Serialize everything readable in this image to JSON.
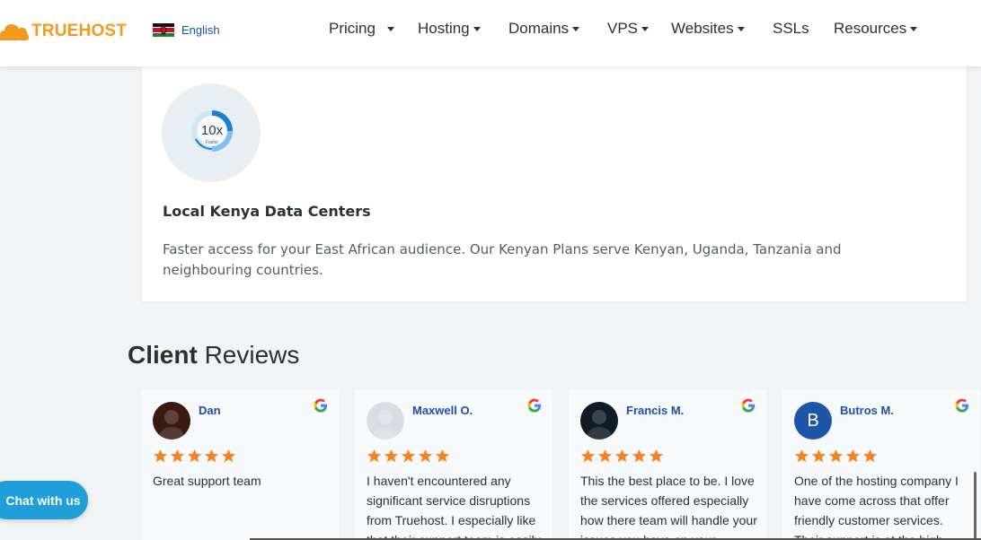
{
  "brand": {
    "name": "TRUEHOST",
    "color": "#f39a1e"
  },
  "language": {
    "label": "English",
    "flag": "kenya-flag-icon"
  },
  "menu": [
    {
      "label": "Pricing",
      "dropdown": true
    },
    {
      "label": "Hosting",
      "dropdown": true
    },
    {
      "label": "Domains",
      "dropdown": true
    },
    {
      "label": "VPS",
      "dropdown": true
    },
    {
      "label": "Websites",
      "dropdown": true
    },
    {
      "label": "SSLs",
      "dropdown": false
    },
    {
      "label": "Resources",
      "dropdown": true
    }
  ],
  "feature": {
    "icon": "speed-gauge-icon",
    "gauge_value": "10x",
    "gauge_caption": "Faster",
    "title": "Local Kenya Data Centers",
    "description": "Faster access for your East African audience. Our Kenyan Plans serve Kenyan, Uganda, Tanzania and neighbouring countries."
  },
  "reviews": {
    "heading_bold": "Client",
    "heading_rest": "Reviews",
    "items": [
      {
        "name": "Dan",
        "rating": 5,
        "text": "Great support team",
        "avatar": "photo",
        "avatar_color": "#3a1a10"
      },
      {
        "name": "Maxwell O.",
        "rating": 5,
        "text": "I haven't encountered any significant service disruptions from Truehost. I especially like that their support team is easily",
        "avatar": "photo",
        "avatar_color": "#d9dde2"
      },
      {
        "name": "Francis M.",
        "rating": 5,
        "text": "This the best place to be. I love the services offered especially how there team will handle your issues you have on your",
        "avatar": "photo",
        "avatar_color": "#0f1c26"
      },
      {
        "name": "Butros M.",
        "rating": 5,
        "text": "One of the hosting company I have come across that offer friendly customer services. Their support is at the high",
        "avatar": "letter",
        "avatar_letter": "B",
        "avatar_color": "#1d56a8"
      }
    ]
  },
  "chat_button": {
    "label": "Chat with us",
    "color": "#1e9fd9"
  },
  "colors": {
    "star": "#f58220",
    "link": "#1d4fa8"
  }
}
